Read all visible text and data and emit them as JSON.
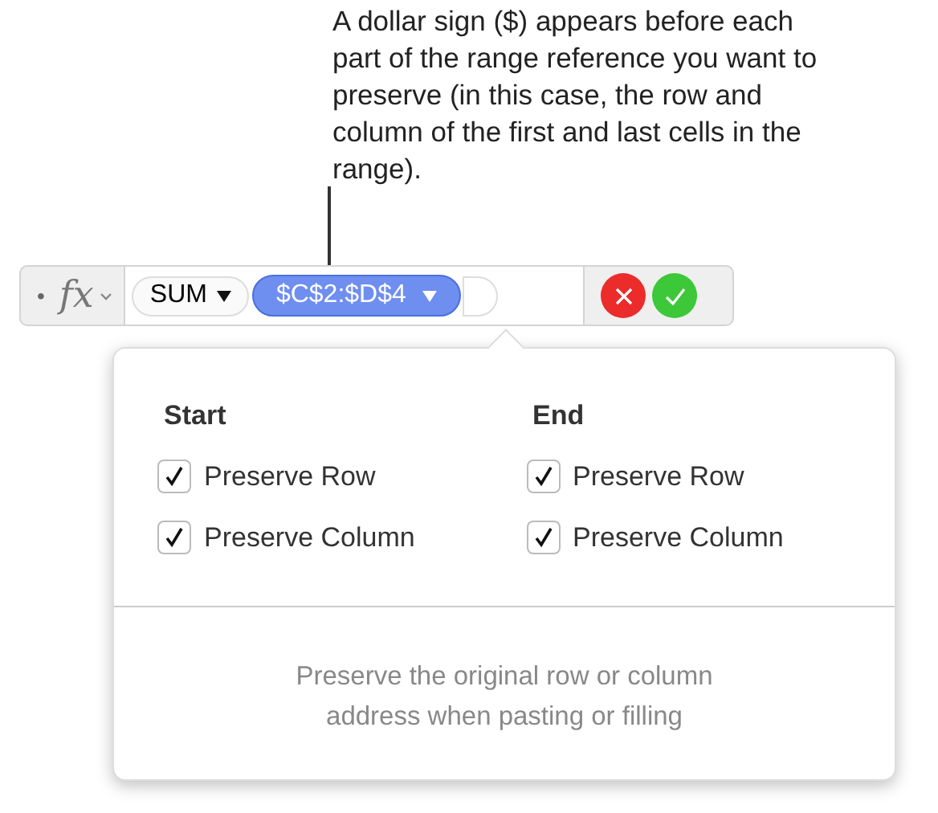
{
  "callout": {
    "text": "A dollar sign ($) appears before each part of the range reference you want to preserve (in this case, the row and column of the first and last cells in the range)."
  },
  "formula_bar": {
    "bullet": "•",
    "fx": "fx",
    "function_token": "SUM",
    "range_token": "$C$2:$D$4"
  },
  "popover": {
    "columns": [
      {
        "heading": "Start",
        "options": [
          {
            "label": "Preserve Row",
            "checked": true
          },
          {
            "label": "Preserve Column",
            "checked": true
          }
        ]
      },
      {
        "heading": "End",
        "options": [
          {
            "label": "Preserve Row",
            "checked": true
          },
          {
            "label": "Preserve Column",
            "checked": true
          }
        ]
      }
    ],
    "description": "Preserve the original row or column address when pasting or filling"
  }
}
